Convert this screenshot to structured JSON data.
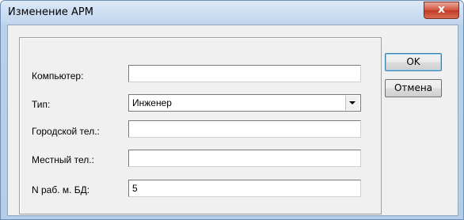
{
  "window": {
    "title": "Изменение АРМ",
    "close_symbol": "x"
  },
  "form": {
    "computer": {
      "label": "Компьютер:",
      "value": ""
    },
    "type": {
      "label": "Тип:",
      "value": "Инженер"
    },
    "city_phone": {
      "label": "Городской тел.:",
      "value": ""
    },
    "local_phone": {
      "label": "Местный тел.:",
      "value": ""
    },
    "workstation_db": {
      "label": "N раб. м. БД:",
      "value": "5"
    }
  },
  "buttons": {
    "ok": "OK",
    "cancel": "Отмена"
  },
  "icons": {
    "close": "close-icon",
    "dropdown": "chevron-down-icon"
  }
}
